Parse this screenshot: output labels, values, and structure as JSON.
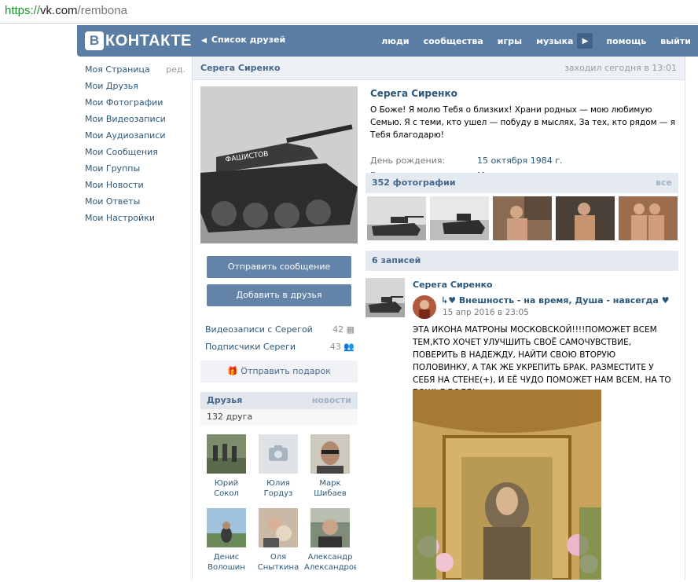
{
  "browser": {
    "scheme": "https://",
    "host": "vk.com",
    "path": "/rembona"
  },
  "header": {
    "logo_letter": "В",
    "logo_text": "КОНТАКТЕ",
    "back_label": "Список друзей",
    "nav": [
      "люди",
      "сообщества",
      "игры",
      "музыка",
      "помощь",
      "выйти"
    ]
  },
  "left_menu": {
    "edit": "ред.",
    "items": [
      "Моя Страница",
      "Мои Друзья",
      "Мои Фотографии",
      "Мои Видеозаписи",
      "Мои Аудиозаписи",
      "Мои Сообщения",
      "Мои Группы",
      "Мои Новости",
      "Мои Ответы",
      "Мои Настройки"
    ]
  },
  "profile": {
    "name": "Серега Сиренко",
    "last_seen": "заходил сегодня в 13:01",
    "status": "О Боже! Я молю Тебя о близких! Храни родных — мою любимую Семью. Я с теми, кто ушел — побуду в мыслях, За тех, кто рядом — я Тебя благодарю!",
    "birthday_label": "День рождения:",
    "birthday_value": "15 октября 1984 г.",
    "city_label": "Город:",
    "city_value": "Марганец"
  },
  "buttons": {
    "send_message": "Отправить сообщение",
    "add_friend": "Добавить в друзья",
    "gift": "Отправить подарок"
  },
  "side_links": [
    {
      "label": "Видеозаписи с Серегой",
      "count": "42"
    },
    {
      "label": "Подписчики Сереги",
      "count": "43"
    }
  ],
  "friends": {
    "title": "Друзья",
    "news": "новости",
    "count": "132 друга",
    "list": [
      {
        "first": "Юрий",
        "last": "Сокол"
      },
      {
        "first": "Юлия",
        "last": "Гордуз"
      },
      {
        "first": "Марк",
        "last": "Шибаев"
      },
      {
        "first": "Денис",
        "last": "Волошин"
      },
      {
        "first": "Оля",
        "last": "Сныткина"
      },
      {
        "first": "Александр",
        "last": "Александрович"
      }
    ]
  },
  "photos": {
    "title": "352 фотографии",
    "all": "все"
  },
  "wall": {
    "title": "6 записей",
    "post": {
      "author": "Серега Сиренко",
      "repost_from": "↳♥ Внешность - на время, Душа - навсегда ♥",
      "date": "15 апр 2016 в 23:05",
      "text": "ЭТА ИКОНА МАТРОНЫ МОСКОВСКОЙ!!!!ПОМОЖЕТ ВСЕМ ТЕМ,КТО ХОЧЕТ УЛУЧШИТЬ СВОЁ САМОЧУВСТВИЕ, ПОВЕРИТЬ В НАДЕЖДУ, НАЙТИ СВОЮ ВТОРУЮ ПОЛОВИНКУ, А ТАК ЖЕ УКРЕПИТЬ БРАК. РАЗМЕСТИТЕ У СЕБЯ НА СТЕНЕ(+), И ЕЁ ЧУДО ПОМОЖЕТ НАМ ВСЕМ, НА ТО БОЖЬЯ ВОЛЯ!"
    }
  }
}
